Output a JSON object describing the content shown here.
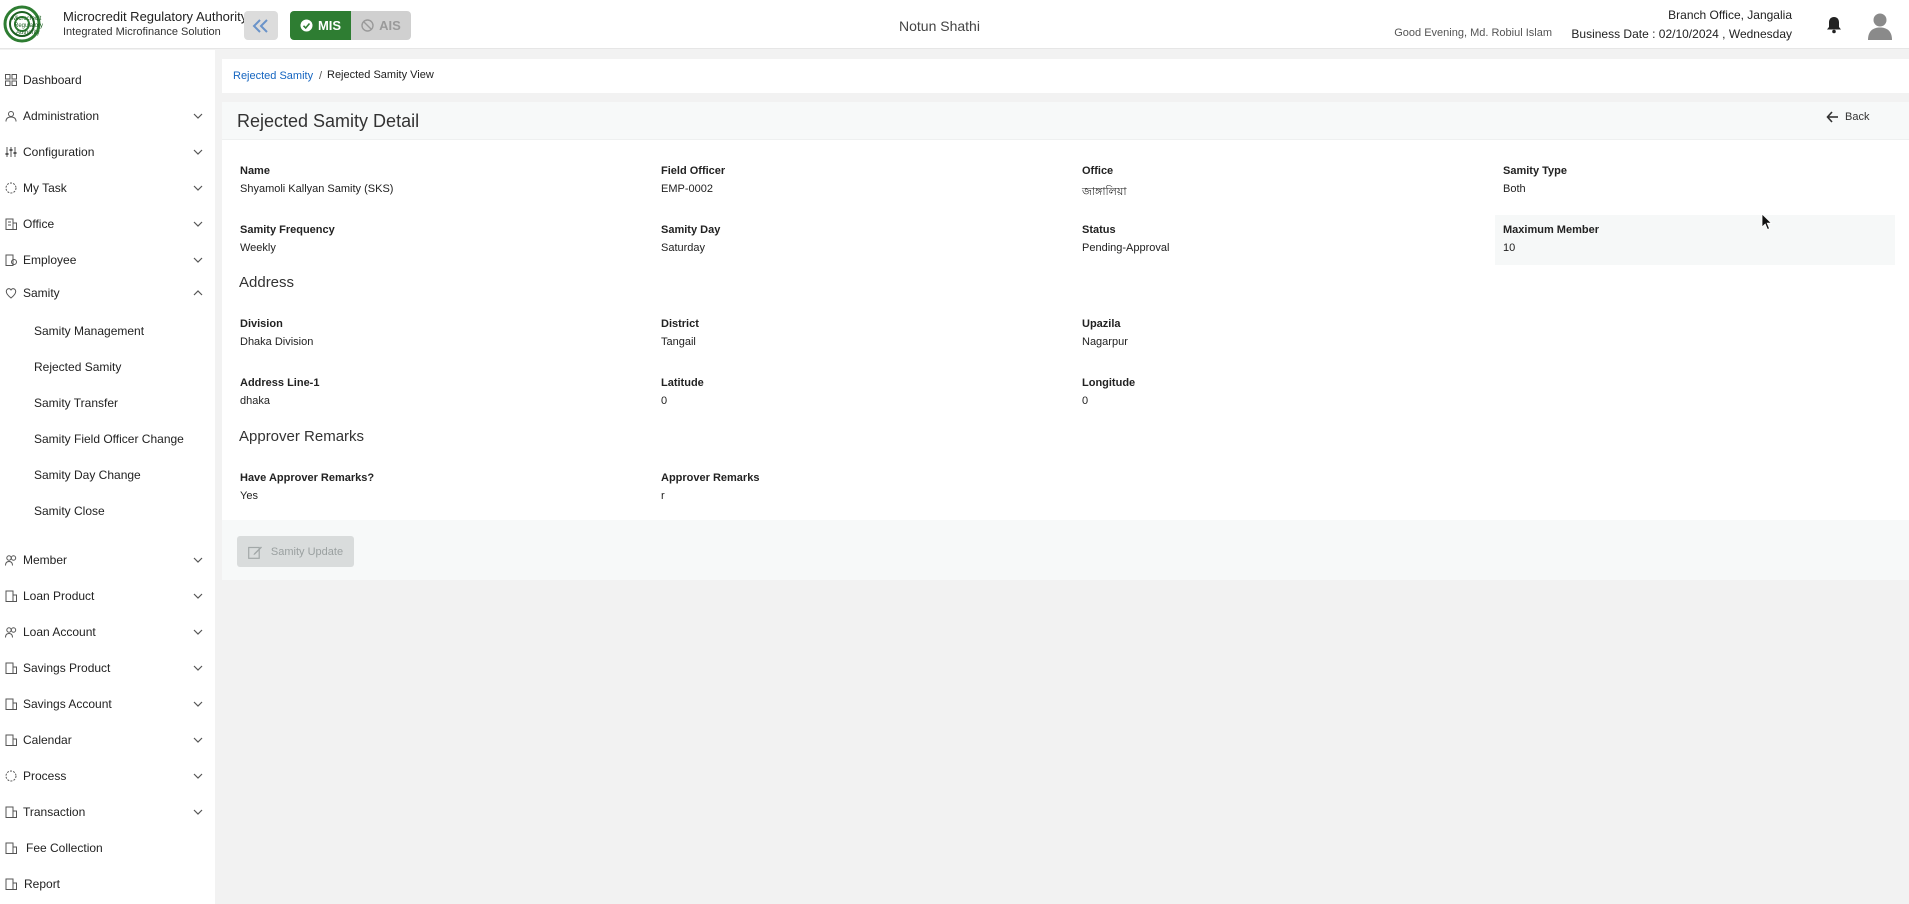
{
  "header": {
    "org_name": "Microcredit Regulatory Authority",
    "org_sub": "Integrated Microfinance Solution",
    "logo_text": [
      "Microcredit",
      "Regulatory",
      "Authority"
    ],
    "modules": {
      "mis": "MIS",
      "ais": "AIS"
    },
    "app_name": "Notun Shathi",
    "greeting": "Good Evening, Md. Robiul Islam",
    "branch": "Branch Office, Jangalia",
    "business_date": "Business Date : 02/10/2024 , Wednesday"
  },
  "sidebar": {
    "items": [
      {
        "label": "Dashboard",
        "icon": "dashboard-icon"
      },
      {
        "label": "Administration",
        "icon": "administration-icon"
      },
      {
        "label": "Configuration",
        "icon": "configuration-icon"
      },
      {
        "label": "My Task",
        "icon": "task-icon"
      },
      {
        "label": "Office",
        "icon": "office-icon"
      },
      {
        "label": "Employee",
        "icon": "employee-icon"
      },
      {
        "label": "Samity",
        "icon": "samity-icon"
      },
      {
        "label": "Member",
        "icon": "member-icon"
      },
      {
        "label": "Loan Product",
        "icon": "loan-product-icon"
      },
      {
        "label": "Loan Account",
        "icon": "loan-account-icon"
      },
      {
        "label": "Savings Product",
        "icon": "savings-product-icon"
      },
      {
        "label": "Savings Account",
        "icon": "savings-account-icon"
      },
      {
        "label": "Calendar",
        "icon": "calendar-icon"
      },
      {
        "label": "Process",
        "icon": "process-icon"
      },
      {
        "label": "Transaction",
        "icon": "transaction-icon"
      },
      {
        "label": "Fee Collection",
        "icon": "fee-collection-icon"
      },
      {
        "label": "Report",
        "icon": "report-icon"
      }
    ],
    "samity_sub": [
      "Samity Management",
      "Rejected Samity",
      "Samity Transfer",
      "Samity Field Officer Change",
      "Samity Day Change",
      "Samity Close"
    ]
  },
  "breadcrumb": {
    "parent": "Rejected Samity",
    "separator": "/",
    "current": "Rejected Samity View"
  },
  "detail": {
    "title": "Rejected Samity Detail",
    "back_label": "Back",
    "fields": {
      "name": {
        "label": "Name",
        "value": "Shyamoli Kallyan Samity (SKS)"
      },
      "field_officer": {
        "label": "Field Officer",
        "value": "EMP-0002"
      },
      "office": {
        "label": "Office",
        "value": "জাঙ্গালিয়া"
      },
      "samity_type": {
        "label": "Samity Type",
        "value": "Both"
      },
      "frequency": {
        "label": "Samity Frequency",
        "value": "Weekly"
      },
      "samity_day": {
        "label": "Samity Day",
        "value": "Saturday"
      },
      "status": {
        "label": "Status",
        "value": "Pending-Approval"
      },
      "max_member": {
        "label": "Maximum Member",
        "value": "10"
      }
    },
    "address": {
      "title": "Address",
      "division": {
        "label": "Division",
        "value": "Dhaka Division"
      },
      "district": {
        "label": "District",
        "value": "Tangail"
      },
      "upazila": {
        "label": "Upazila",
        "value": "Nagarpur"
      },
      "address_line1": {
        "label": "Address Line-1",
        "value": "dhaka"
      },
      "latitude": {
        "label": "Latitude",
        "value": "0"
      },
      "longitude": {
        "label": "Longitude",
        "value": "0"
      }
    },
    "remarks": {
      "title": "Approver Remarks",
      "have_remarks": {
        "label": "Have Approver Remarks?",
        "value": "Yes"
      },
      "remarks": {
        "label": "Approver Remarks",
        "value": "r"
      }
    },
    "update_label": "Samity Update"
  },
  "colors": {
    "accent": "#2e7d32",
    "link": "#1565c0"
  }
}
